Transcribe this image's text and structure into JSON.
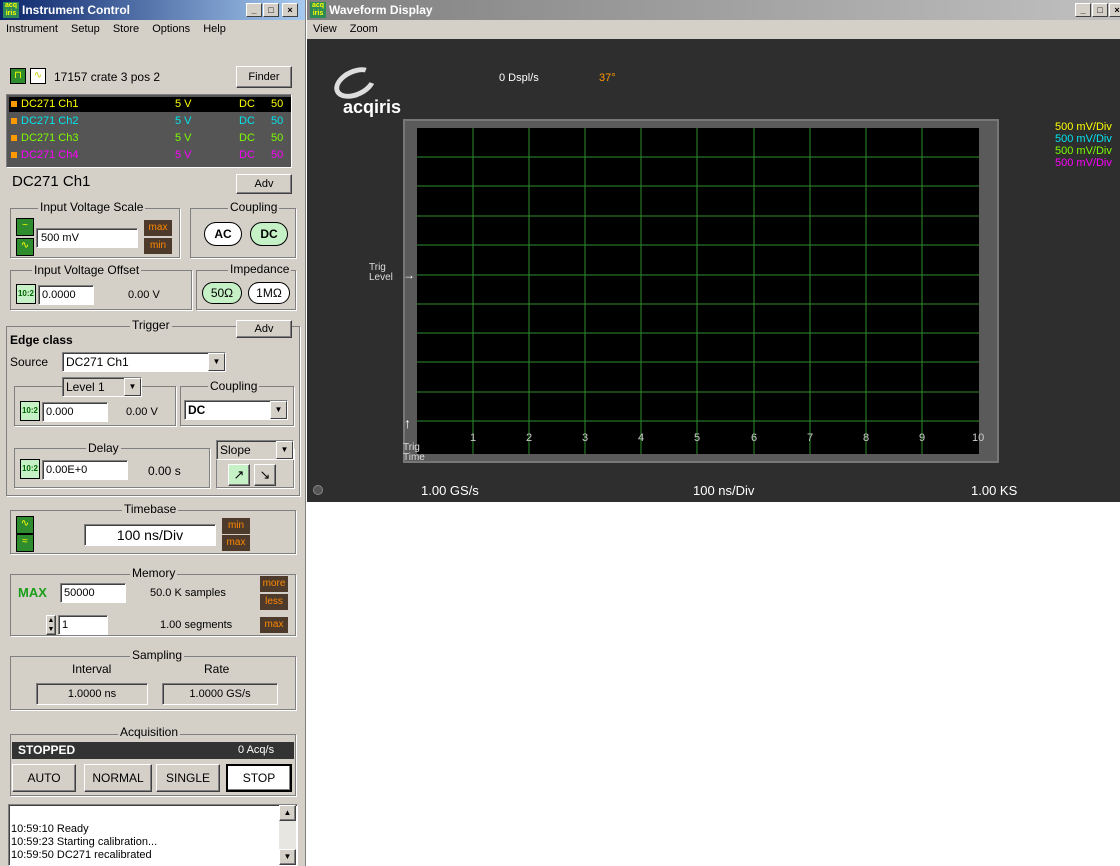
{
  "instrument_window": {
    "title": "Instrument Control",
    "app_icon_text": "acq iris",
    "menu": [
      "Instrument",
      "Setup",
      "Store",
      "Options",
      "Help"
    ],
    "device_label": "17157 crate 3 pos 2",
    "finder_label": "Finder",
    "channels": [
      {
        "name": "DC271 Ch1",
        "volts": "5 V",
        "coupling": "DC",
        "ohms": "50",
        "color": "#ffff00",
        "selected": true
      },
      {
        "name": "DC271 Ch2",
        "volts": "5 V",
        "coupling": "DC",
        "ohms": "50",
        "color": "#00e5ee"
      },
      {
        "name": "DC271 Ch3",
        "volts": "5 V",
        "coupling": "DC",
        "ohms": "50",
        "color": "#7cfc00"
      },
      {
        "name": "DC271 Ch4",
        "volts": "5 V",
        "coupling": "DC",
        "ohms": "50",
        "color": "#ff00ff"
      }
    ],
    "selected_channel": "DC271 Ch1",
    "adv_label": "Adv",
    "input_voltage_scale": {
      "label": "Input Voltage Scale",
      "value": "500 mV",
      "max": "max",
      "min": "min"
    },
    "coupling": {
      "label": "Coupling",
      "ac": "AC",
      "dc": "DC"
    },
    "input_voltage_offset": {
      "label": "Input Voltage Offset",
      "value": "0.0000",
      "readout": "0.00 V"
    },
    "impedance": {
      "label": "Impedance",
      "opt1": "50Ω",
      "opt2": "1MΩ"
    },
    "trigger": {
      "label": "Trigger",
      "adv": "Adv",
      "class": "Edge class",
      "source_label": "Source",
      "source": "DC271 Ch1",
      "level_select": "Level 1",
      "level_value": "0.000",
      "level_readout": "0.00 V",
      "coupling_label": "Coupling",
      "coupling_value": "DC",
      "delay_label": "Delay",
      "delay_value": "0.00E+0",
      "delay_readout": "0.00 s",
      "slope_label": "Slope"
    },
    "timebase": {
      "label": "Timebase",
      "value": "100 ns/Div",
      "min": "min",
      "max": "max"
    },
    "memory": {
      "label": "Memory",
      "max_label": "MAX",
      "samples_value": "50000",
      "samples_readout": "50.0 K samples",
      "segments_value": "1",
      "segments_readout": "1.00 segments",
      "more": "more",
      "less": "less",
      "max": "max"
    },
    "sampling": {
      "label": "Sampling",
      "interval_label": "Interval",
      "rate_label": "Rate",
      "interval": "1.0000 ns",
      "rate": "1.0000 GS/s"
    },
    "acquisition": {
      "label": "Acquisition",
      "status": "STOPPED",
      "rate": "0 Acq/s",
      "auto": "AUTO",
      "normal": "NORMAL",
      "single": "SINGLE",
      "stop": "STOP"
    },
    "log": [
      "10:59:10 Ready",
      "10:59:23 Starting calibration...",
      "10:59:50 DC271 recalibrated"
    ]
  },
  "waveform_window": {
    "title": "Waveform Display",
    "menu": [
      "View",
      "Zoom"
    ],
    "logo": "acqiris",
    "display_rate": "0 Dspl/s",
    "temperature": "37°",
    "channel_scales": [
      {
        "text": "500 mV/Div",
        "color": "#ffff00"
      },
      {
        "text": "500 mV/Div",
        "color": "#00e5ee"
      },
      {
        "text": "500 mV/Div",
        "color": "#7cfc00"
      },
      {
        "text": "500 mV/Div",
        "color": "#ff00ff"
      }
    ],
    "trig_level_label": "Trig Level",
    "trig_time_label": "Trig Time",
    "x_ticks": [
      "1",
      "2",
      "3",
      "4",
      "5",
      "6",
      "7",
      "8",
      "9",
      "10"
    ],
    "sample_rate": "1.00 GS/s",
    "time_per_div": "100 ns/Div",
    "record_length": "1.00 KS"
  }
}
